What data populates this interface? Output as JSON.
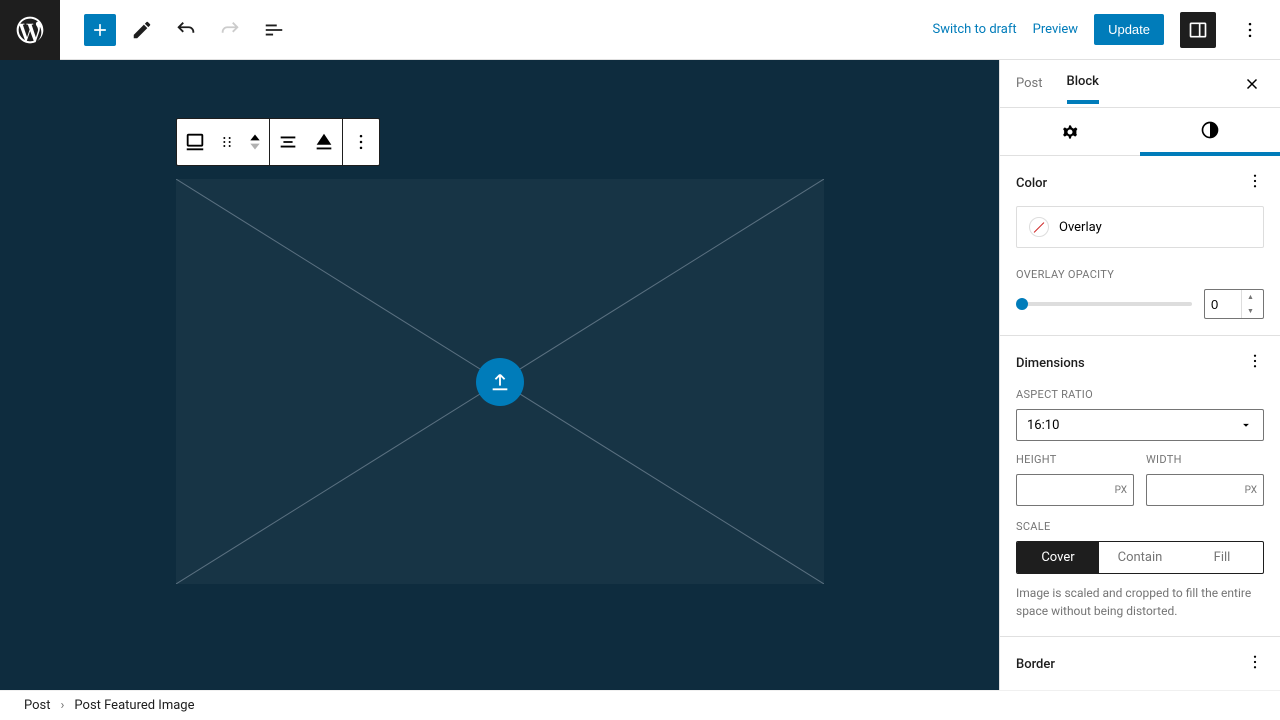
{
  "toolbar": {
    "switch_to_draft": "Switch to draft",
    "preview": "Preview",
    "update": "Update"
  },
  "sidebar": {
    "tabs": {
      "post": "Post",
      "block": "Block"
    },
    "color": {
      "title": "Color",
      "overlay": "Overlay",
      "opacity_label": "OVERLAY OPACITY",
      "opacity_value": "0"
    },
    "dimensions": {
      "title": "Dimensions",
      "aspect_label": "ASPECT RATIO",
      "aspect_value": "16:10",
      "height_label": "HEIGHT",
      "width_label": "WIDTH",
      "height_value": "",
      "width_value": "",
      "unit": "PX",
      "scale_label": "SCALE",
      "scale_options": {
        "cover": "Cover",
        "contain": "Contain",
        "fill": "Fill"
      },
      "scale_help": "Image is scaled and cropped to fill the entire space without being distorted."
    },
    "border": {
      "title": "Border"
    }
  },
  "footer": {
    "crumb1": "Post",
    "crumb2": "Post Featured Image"
  }
}
